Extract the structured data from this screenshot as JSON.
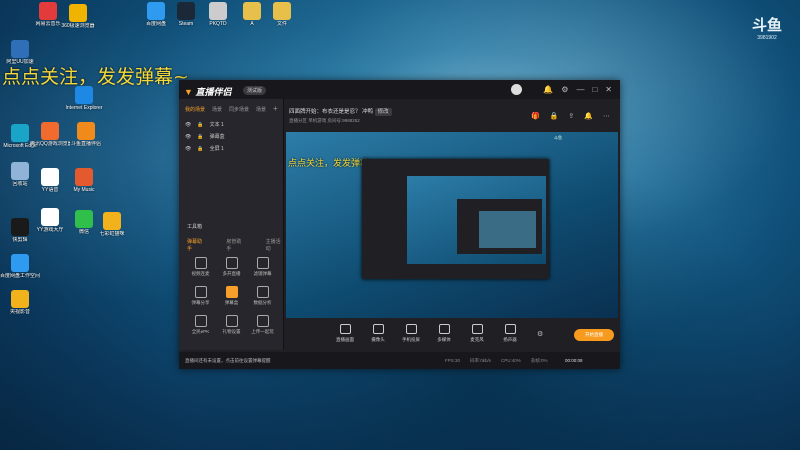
{
  "desktop": {
    "icons": [
      {
        "label": "网易云音乐",
        "color": "#e23b3b"
      },
      {
        "label": "360极速浏览器",
        "color": "#f0b300"
      },
      {
        "label": "阿里UU加速",
        "color": "#2f6fb7"
      },
      {
        "label": "百度网盘",
        "color": "#2e9bf0"
      },
      {
        "label": "Steam",
        "color": "#1b2838"
      },
      {
        "label": "PKQTD",
        "color": "#cccccc"
      },
      {
        "label": "A",
        "color": "#e6c04a"
      },
      {
        "label": "文件",
        "color": "#e6c04a"
      },
      {
        "label": "Internet Explorer",
        "color": "#1e88e5"
      },
      {
        "label": "Microsoft Edge",
        "color": "#1aa4c7"
      },
      {
        "label": "腾讯QQ游戏浏览器",
        "color": "#f06b2d"
      },
      {
        "label": "斗鱼直播伴侣",
        "color": "#f08a1b"
      },
      {
        "label": "回收站",
        "color": "#8fb4d8"
      },
      {
        "label": "YY语音",
        "color": "#ffffff"
      },
      {
        "label": "My Music",
        "color": "#e45a2f"
      },
      {
        "label": "YY游戏大厅",
        "color": "#ffffff"
      },
      {
        "label": "微信",
        "color": "#2fbf4a"
      },
      {
        "label": "七彩虹猫咪",
        "color": "#f2b21b"
      },
      {
        "label": "快剪辑",
        "color": "#1a1a1a"
      },
      {
        "label": "百度网盘工作空间",
        "color": "#2e9bf0"
      },
      {
        "label": "央视影音",
        "color": "#f2b21b"
      }
    ],
    "banner": "点点关注，发发弹幕~",
    "watermark_big": "斗鱼",
    "watermark_small": "3981902"
  },
  "app": {
    "logo": "直播伴侣",
    "version_badge": "测试版",
    "title_icons": [
      "bell-icon",
      "gear-icon",
      "minimize-icon",
      "maximize-icon",
      "close-icon"
    ],
    "left_tabs": [
      "我的场景",
      "场景",
      "同步场景",
      "场景"
    ],
    "sources": [
      "文本 1",
      "弹幕盒",
      "全屏 1"
    ],
    "tools_title": "工具箱",
    "tools_tabs": [
      "弹幕助手",
      "房管助手",
      "主播活动"
    ],
    "tools": [
      {
        "label": "视频连麦"
      },
      {
        "label": "多开直播"
      },
      {
        "label": "滤镜弹幕"
      },
      {
        "label": "弹幕分享"
      },
      {
        "label": "弹幕盒"
      },
      {
        "label": "数据分析"
      },
      {
        "label": "全民ePK"
      },
      {
        "label": "礼物设置"
      },
      {
        "label": "上传一起玩"
      }
    ],
    "room_title": "四面牌开始：布衣还是是忍？ 冲鸭",
    "room_title_tag": "修改",
    "room_sub": "直播分区 单机游戏  房间号:9988252",
    "main_icons": [
      "gift-icon",
      "lock-icon",
      "share-icon",
      "bell-icon",
      "more-icon"
    ],
    "preview_banner": "点点关注，发发弹幕~",
    "preview_logo": "斗鱼",
    "bottom_items": [
      "直播画面",
      "摄像头",
      "手机投屏",
      "多媒体",
      "麦克风",
      "扬声器"
    ],
    "start_button": "开始直播",
    "status_warn": "直播间还有未设置，点击前往设置弹幕提醒",
    "status_stats": [
      "FPS:30",
      "码率:0kb/s",
      "CPU:40%",
      "丢帧:0%"
    ],
    "timer": "00:00:08"
  }
}
